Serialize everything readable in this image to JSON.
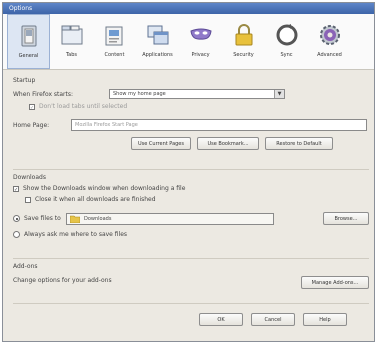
{
  "window": {
    "title": "Options"
  },
  "tabs": [
    {
      "label": "General",
      "icon": "switch-icon"
    },
    {
      "label": "Tabs",
      "icon": "tabs-icon"
    },
    {
      "label": "Content",
      "icon": "content-icon"
    },
    {
      "label": "Applications",
      "icon": "applications-icon"
    },
    {
      "label": "Privacy",
      "icon": "privacy-mask-icon"
    },
    {
      "label": "Security",
      "icon": "padlock-icon"
    },
    {
      "label": "Sync",
      "icon": "sync-icon"
    },
    {
      "label": "Advanced",
      "icon": "gear-icon"
    }
  ],
  "startup": {
    "heading": "Startup",
    "when_label": "When Firefox starts:",
    "when_value": "Show my home page",
    "sub_check": "Don't load tabs until selected",
    "home_label": "Home Page:",
    "home_placeholder": "Mozilla Firefox Start Page",
    "btn_current": "Use Current Pages",
    "btn_bookmark": "Use Bookmark...",
    "btn_restore": "Restore to Default"
  },
  "downloads": {
    "heading": "Downloads",
    "show_window": "Show the Downloads window when downloading a file",
    "close_when_done": "Close it when all downloads are finished",
    "save_to_label": "Save files to",
    "folder": "Downloads",
    "browse": "Browse...",
    "always_ask": "Always ask me where to save files"
  },
  "addons": {
    "heading": "Add-ons",
    "desc": "Change options for your add-ons",
    "manage": "Manage Add-ons..."
  },
  "footer": {
    "ok": "OK",
    "cancel": "Cancel",
    "help": "Help"
  },
  "colors": {
    "accent": "#3d64a8",
    "window_bg": "#ece9e2"
  }
}
